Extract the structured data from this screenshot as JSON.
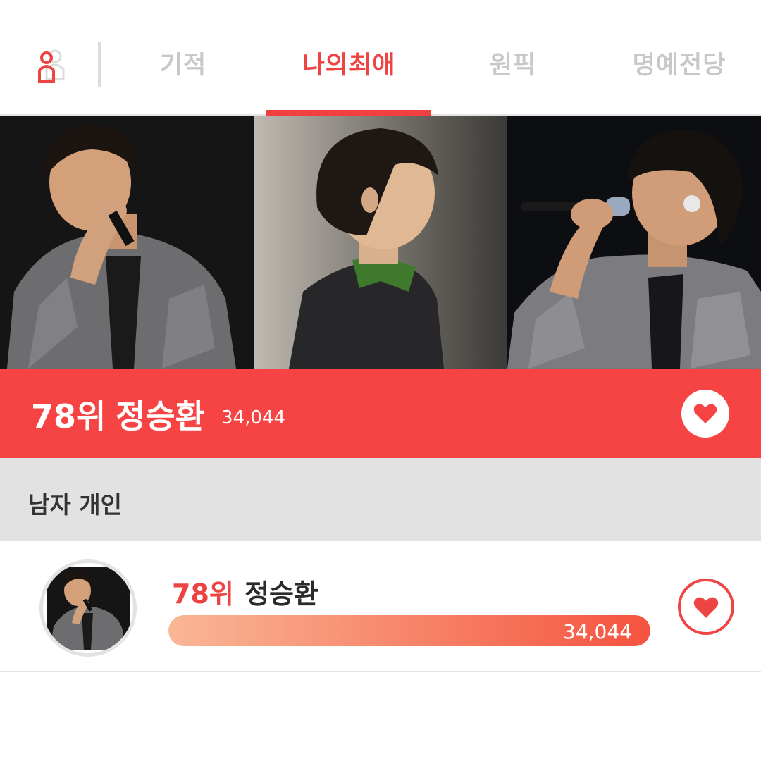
{
  "tabs": {
    "items": [
      {
        "label": "기적",
        "active": false
      },
      {
        "label": "나의최애",
        "active": true
      },
      {
        "label": "원픽",
        "active": false
      },
      {
        "label": "명예전당",
        "active": false
      }
    ],
    "user_icon": "person-icon"
  },
  "banner": {
    "rank": "78위",
    "name": "정승환",
    "votes": "34,044",
    "heart_icon": "heart-icon"
  },
  "category": {
    "label": "남자 개인"
  },
  "ranking_row": {
    "rank": "78위",
    "name": "정승환",
    "votes": "34,044",
    "progress_fraction": 1.0,
    "heart_icon": "heart-icon"
  },
  "colors": {
    "accent": "#f64444",
    "tab_inactive": "#c8c8c8",
    "progress_start": "#f9b796",
    "progress_end": "#f5533f",
    "category_bg": "#e2e2e2"
  }
}
